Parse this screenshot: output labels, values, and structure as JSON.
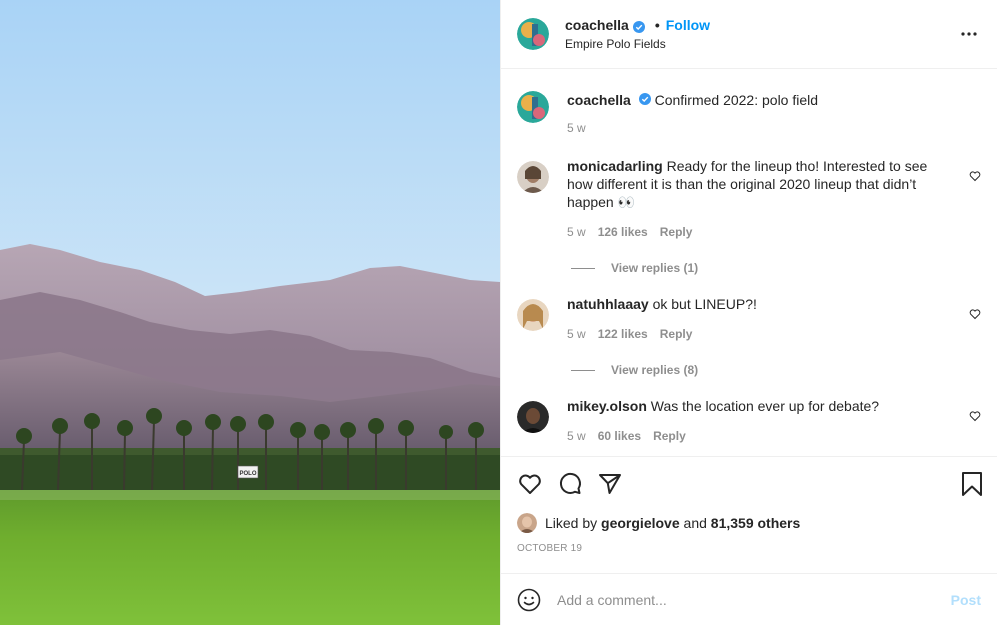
{
  "post": {
    "username": "coachella",
    "follow_label": "Follow",
    "separator": "•",
    "location": "Empire Polo Fields",
    "caption_text": "Confirmed 2022: polo field",
    "caption_time": "5 w",
    "sign_text": "POLO"
  },
  "comments": [
    {
      "username": "monicadarling",
      "text": "Ready for the lineup tho! Interested to see how different it is than the original 2020 lineup that didn’t happen 👀",
      "time": "5 w",
      "likes": "126 likes",
      "reply_label": "Reply",
      "view_replies": "View replies (1)"
    },
    {
      "username": "natuhhlaaay",
      "text": "ok but LINEUP?!",
      "time": "5 w",
      "likes": "122 likes",
      "reply_label": "Reply",
      "view_replies": "View replies (8)"
    },
    {
      "username": "mikey.olson",
      "text": "Was the location ever up for debate?",
      "time": "5 w",
      "likes": "60 likes",
      "reply_label": "Reply"
    }
  ],
  "likes": {
    "prefix": "Liked by",
    "user": "georgielove",
    "and": "and",
    "count": "81,359 others"
  },
  "date": "OCTOBER 19",
  "composer": {
    "placeholder": "Add a comment...",
    "post_label": "Post"
  },
  "icons": {
    "more": "more-horizontal-icon",
    "like": "heart-icon",
    "comment": "comment-bubble-icon",
    "share": "paper-plane-icon",
    "save": "bookmark-icon",
    "emoji": "smiley-icon",
    "verified": "verified-badge-icon"
  },
  "colors": {
    "accent": "#0095f6",
    "post_disabled": "#b2dffc",
    "secondary_text": "#8e8e8e",
    "border": "#efefef"
  }
}
